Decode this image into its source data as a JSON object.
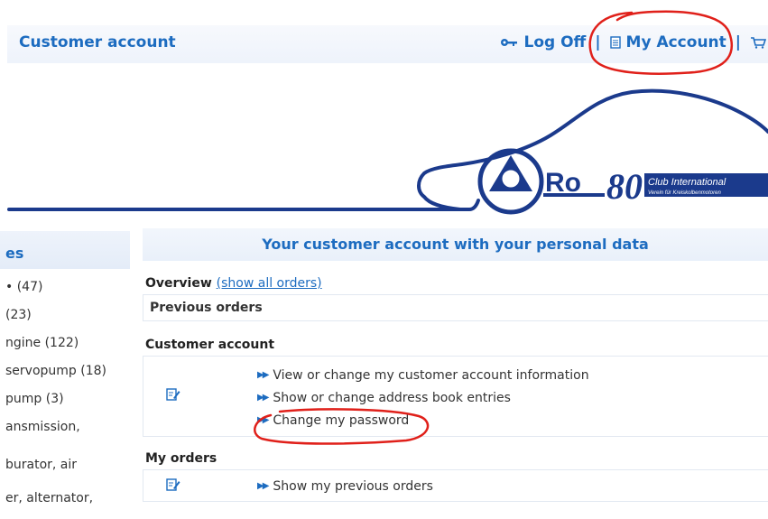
{
  "header": {
    "title": "Customer account",
    "logoff_label": "Log Off",
    "myaccount_label": "My Account",
    "separator": "|"
  },
  "icons": {
    "key": "key-icon",
    "document": "document-icon",
    "cart": "cart-icon",
    "edit": "edit-icon",
    "arrow": "double-arrow-icon"
  },
  "logo": {
    "main_text": "Ro",
    "number": "80",
    "line1": "Club International",
    "line2": "Verein für Kreiskolbenmotoren"
  },
  "sidebar": {
    "heading": "es",
    "items": [
      {
        "label": "• (47)"
      },
      {
        "label": "(23)"
      },
      {
        "label": "ngine (122)"
      },
      {
        "label": "servopump (18)"
      },
      {
        "label": "pump (3)"
      },
      {
        "label_line1": "ansmission,",
        "label_line2": ""
      },
      {
        "label": "burator, air"
      },
      {
        "label": "er, alternator,"
      }
    ]
  },
  "main": {
    "heading": "Your customer account with your personal data",
    "overview_label": "Overview",
    "show_all_orders": "(show all orders)",
    "previous_orders_label": "Previous orders",
    "customer_account_label": "Customer account",
    "account_links": [
      "View or change my customer account information",
      "Show or change address book entries",
      "Change my password"
    ],
    "my_orders_label": "My orders",
    "order_link": "Show my previous orders"
  },
  "colors": {
    "accent": "#1d6cc0",
    "logo_blue": "#1b3a8c",
    "annotation_red": "#e0201a"
  }
}
